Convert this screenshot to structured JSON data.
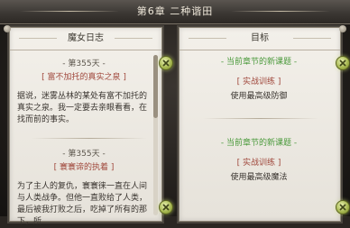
{
  "window": {
    "title": "第6章 二种谐田"
  },
  "diary": {
    "header": "魔女日志",
    "entries": [
      {
        "day": "- 第355天 -",
        "subtitle": "[ 富不加托的真实之泉 ]",
        "text": "据说，迷雾丛林的某处有富不加托的真实之泉。我一定要去亲眼看看，在找而前的事实。"
      },
      {
        "day": "- 第355天 -",
        "subtitle": "[ 寰寰谛的执着 ]",
        "text": "为了主人的复仇，寰寰徕一直在人间与人类战争。但他一直败给了人类，最后被我打败之后，吃掉了所有的那下，所"
      }
    ]
  },
  "goals": {
    "header": "目标",
    "items": [
      {
        "head": "- 当前章节的新课题 -",
        "tag": "[ 实战训练 ]",
        "desc": "使用最高级防御"
      },
      {
        "head": "- 当前章节的新课题 -",
        "tag": "[ 实战训练 ]",
        "desc": "使用最高级魔法"
      }
    ]
  }
}
